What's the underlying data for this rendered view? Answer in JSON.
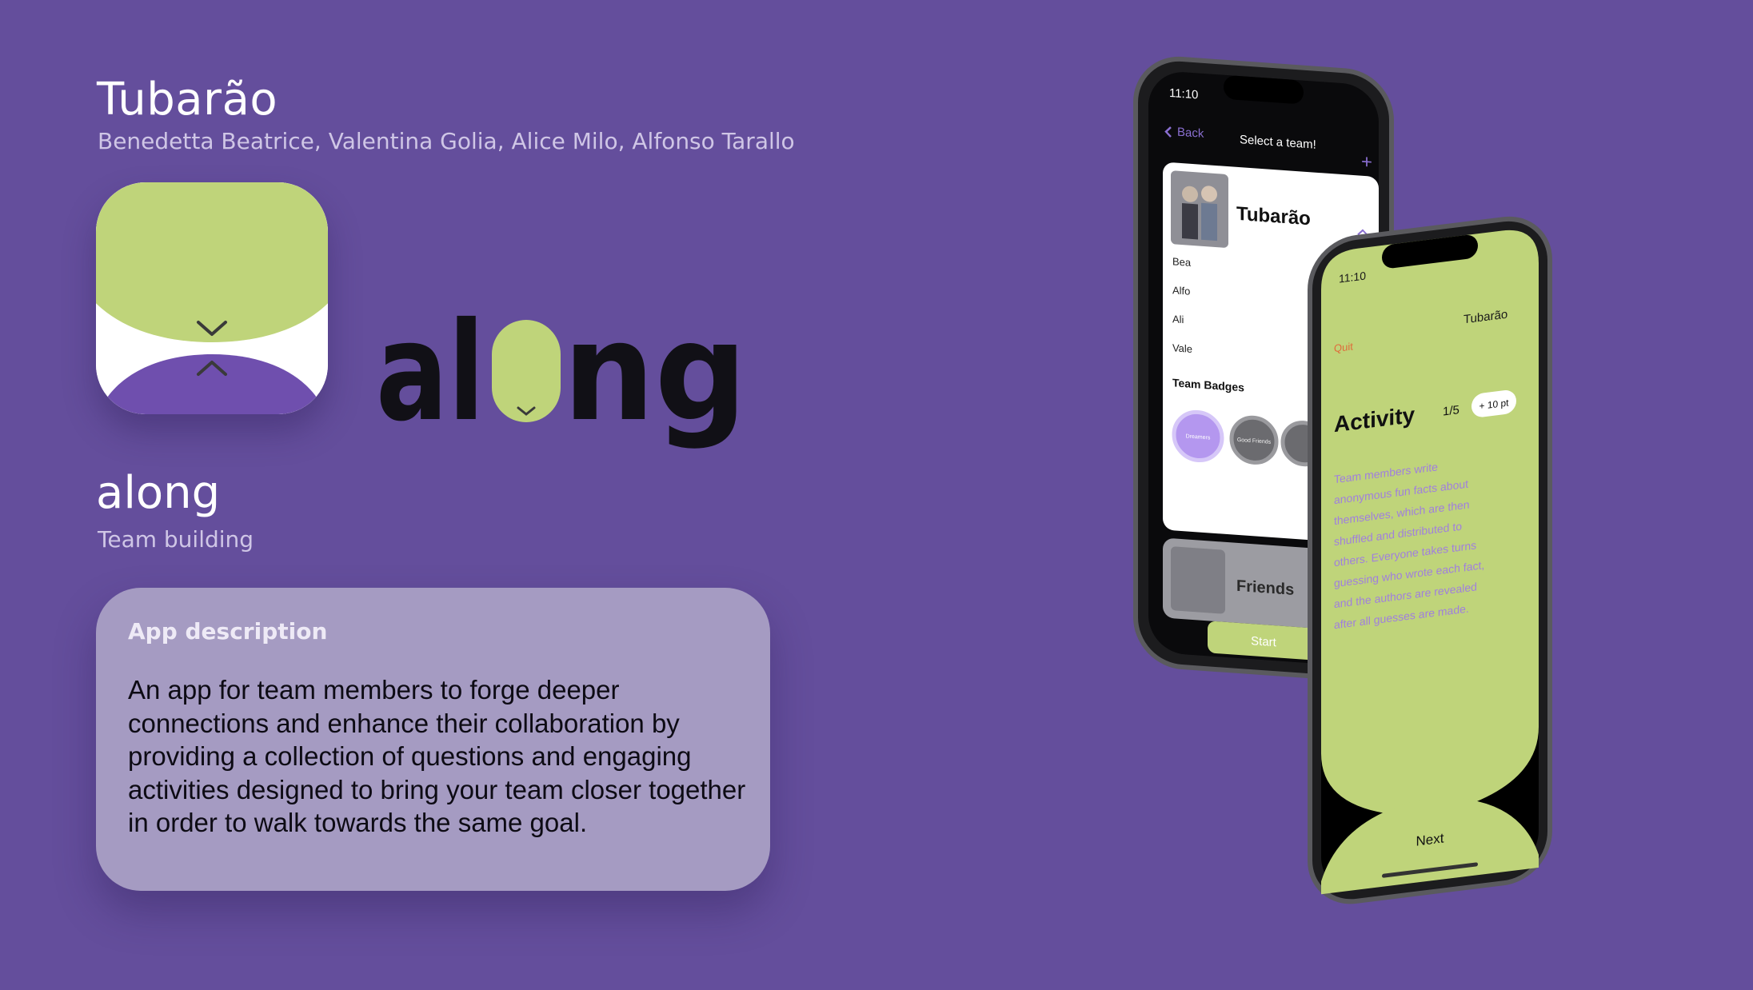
{
  "header": {
    "team_name": "Tubarão",
    "authors": "Benedetta Beatrice, Valentina Golia, Alice Milo, Alfonso Tarallo"
  },
  "logo": {
    "wordmark": "along"
  },
  "app": {
    "name": "along",
    "category": "Team building"
  },
  "description": {
    "heading": "App description",
    "body": "An app for team members to forge deeper connections and enhance their collaboration by providing a collection of questions and engaging activities designed to bring your team closer together in order to walk towards the same goal."
  },
  "phone_back": {
    "time": "11:10",
    "back_label": "Back",
    "title": "Select a team!",
    "add_symbol": "+",
    "team_name": "Tubarão",
    "members": [
      "Bea",
      "Alfo",
      "Ali",
      "Vale"
    ],
    "badges_heading": "Team Badges",
    "badges": [
      "Dreamers",
      "Good Friends"
    ],
    "second_team": "Friends",
    "start_label": "Start"
  },
  "phone_front": {
    "time": "11:10",
    "team_name": "Tubarão",
    "quit_label": "Quit",
    "activity_title": "Activity",
    "progress": "1/5",
    "points": "+ 10 pt",
    "activity_lines": [
      "Team members write",
      "anonymous fun facts about",
      "themselves, which are then",
      "shuffled and distributed to",
      "others. Everyone takes turns",
      "guessing who wrote each fact,",
      "and the authors are revealed",
      "after all guesses are made."
    ],
    "next_label": "Next"
  },
  "colors": {
    "background": "#644e9c",
    "accent_green": "#bfd47a",
    "accent_purple": "#6f4fae",
    "card": "#a59bc2",
    "quit_orange": "#e06a3a"
  }
}
